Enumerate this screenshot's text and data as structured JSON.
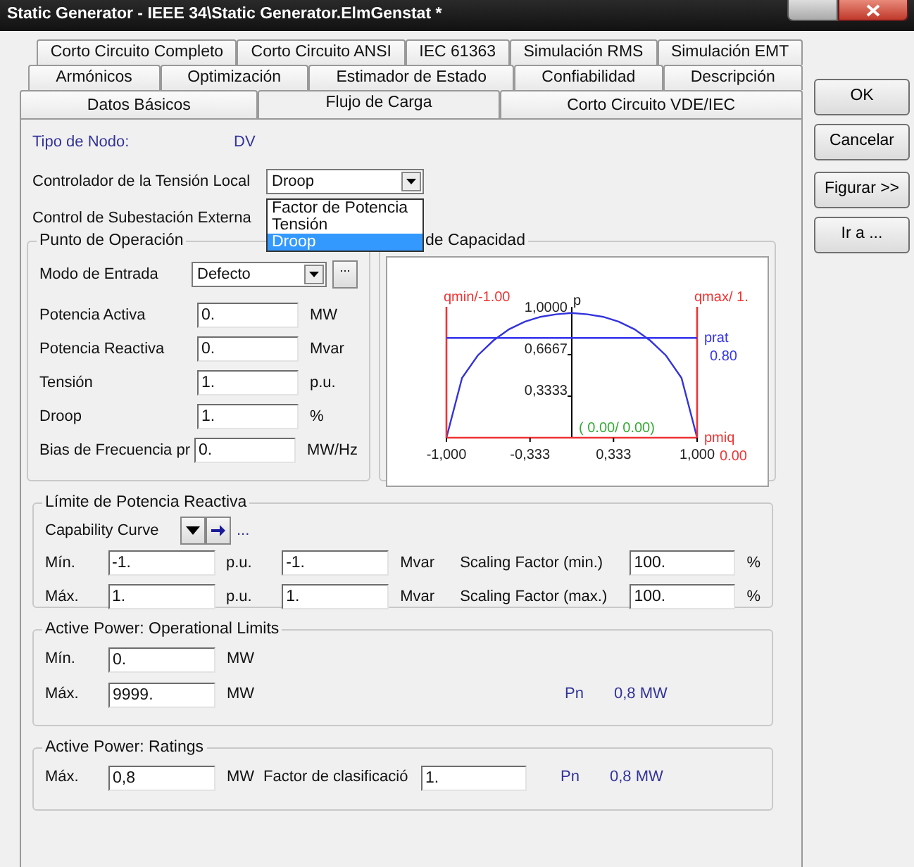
{
  "window": {
    "title": "Static Generator - IEEE 34\\Static Generator.ElmGenstat *"
  },
  "tab_rows": [
    [
      {
        "label": "Corto Circuito Completo",
        "selected": false
      },
      {
        "label": "Corto Circuito ANSI",
        "selected": false
      },
      {
        "label": "IEC 61363",
        "selected": false
      },
      {
        "label": "Simulación RMS",
        "selected": false
      },
      {
        "label": "Simulación EMT",
        "selected": false
      }
    ],
    [
      {
        "label": "Armónicos",
        "selected": false
      },
      {
        "label": "Optimización",
        "selected": false
      },
      {
        "label": "Estimador de Estado",
        "selected": false
      },
      {
        "label": "Confiabilidad",
        "selected": false
      },
      {
        "label": "Descripción",
        "selected": false
      }
    ],
    [
      {
        "label": "Datos Básicos",
        "selected": false
      },
      {
        "label": "Flujo de Carga",
        "selected": true
      },
      {
        "label": "Corto Circuito VDE/IEC",
        "selected": false
      }
    ]
  ],
  "buttons": [
    {
      "label": "OK"
    },
    {
      "label": "Cancelar"
    },
    {
      "label": "Figurar >>"
    },
    {
      "label": "Ir a ..."
    }
  ],
  "node_type": {
    "label": "Tipo de Nodo:",
    "value": "DV"
  },
  "local_voltage_controller": {
    "label": "Controlador de la Tensión Local",
    "value": "Droop",
    "expanded": true,
    "options": [
      {
        "label": "Factor de Potencia",
        "selected": false
      },
      {
        "label": "Tensión",
        "selected": false
      },
      {
        "label": "Droop",
        "selected": true
      }
    ]
  },
  "external_substation_control": {
    "label": "Control de Subestación Externa"
  },
  "operating_point": {
    "title": "Punto de Operación",
    "input_mode": {
      "label": "Modo de Entrada",
      "value": "Defecto",
      "button": "..."
    },
    "fields": [
      {
        "label": "Potencia Activa",
        "value": "0.",
        "unit": "MW"
      },
      {
        "label": "Potencia Reactiva",
        "value": "0.",
        "unit": "Mvar"
      },
      {
        "label": "Tensión",
        "value": "1.",
        "unit": "p.u."
      },
      {
        "label": "Droop",
        "value": "1.",
        "unit": "%"
      },
      {
        "label": "Bias de Frecuencia pr",
        "value": "0.",
        "unit": "MW/Hz"
      }
    ]
  },
  "capability_panel": {
    "title": "de Capacidad",
    "chart_data": {
      "type": "line",
      "ylabel": "p",
      "x": [
        -1,
        -0.875,
        -0.75,
        -0.625,
        -0.5,
        -0.375,
        -0.25,
        -0.125,
        0,
        0.125,
        0.25,
        0.375,
        0.5,
        0.625,
        0.75,
        0.875,
        1
      ],
      "series": [
        {
          "color": "#3333dd",
          "values": [
            0,
            0.48,
            0.66,
            0.78,
            0.87,
            0.93,
            0.97,
            0.99,
            1,
            0.99,
            0.97,
            0.93,
            0.87,
            0.78,
            0.66,
            0.48,
            0
          ]
        }
      ],
      "xlim": [
        -1,
        1
      ],
      "ylim": [
        0,
        1.05
      ],
      "xticks": [
        {
          "value": -1,
          "label": "-1,000"
        },
        {
          "value": -0.333,
          "label": "-0,333"
        },
        {
          "value": 0.333,
          "label": "0,333"
        },
        {
          "value": 1,
          "label": "1,000"
        }
      ],
      "yticks": [
        {
          "value": 0.3333,
          "label": "0,3333"
        },
        {
          "value": 0.6667,
          "label": "0,6667"
        },
        {
          "value": 1,
          "label": "1,0000"
        }
      ],
      "ref_lines": [
        {
          "axis": "x",
          "value": -1,
          "color": "#ee3333",
          "label": "qmin/-1.00"
        },
        {
          "axis": "x",
          "value": 1,
          "color": "#ee3333",
          "label": "qmax/ 1."
        },
        {
          "axis": "y",
          "value": 0.8,
          "color": "#3333ee",
          "label": "prat"
        }
      ],
      "annotations": [
        "0.80",
        "pmiq",
        "0.00",
        "( 0.00/ 0.00)"
      ]
    }
  },
  "reactive_limit": {
    "title": "Límite de Potencia Reactiva",
    "curve_label": "Capability Curve",
    "curve_link": "...",
    "rows": [
      {
        "label": "Mín.",
        "pu": "-1.",
        "pu_unit": "p.u.",
        "mvar": "-1.",
        "mvar_unit": "Mvar",
        "factor_label": "Scaling Factor (min.)",
        "factor": "100.",
        "factor_unit": "%"
      },
      {
        "label": "Máx.",
        "pu": "1.",
        "pu_unit": "p.u.",
        "mvar": "1.",
        "mvar_unit": "Mvar",
        "factor_label": "Scaling Factor (max.)",
        "factor": "100.",
        "factor_unit": "%"
      }
    ]
  },
  "operational_limits": {
    "title": "Active Power: Operational Limits",
    "rows": [
      {
        "label": "Mín.",
        "value": "0.",
        "unit": "MW"
      },
      {
        "label": "Máx.",
        "value": "9999.",
        "unit": "MW",
        "pn_label": "Pn",
        "pn_value": "0,8 MW"
      }
    ]
  },
  "ratings": {
    "title": "Active Power: Ratings",
    "label": "Máx.",
    "value": "0,8",
    "unit": "MW",
    "factor_label": "Factor de clasificació",
    "factor": "1.",
    "pn_label": "Pn",
    "pn_value": "0,8 MW"
  }
}
